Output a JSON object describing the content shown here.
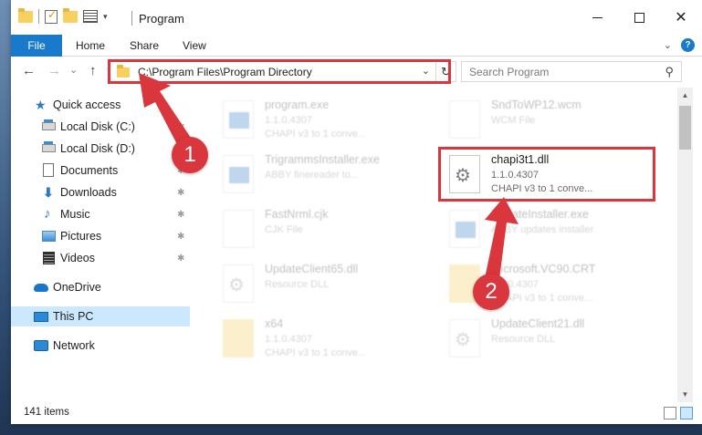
{
  "window": {
    "title": "Program",
    "controls": {
      "minimize": "—",
      "maximize": "☐",
      "close": "✕"
    }
  },
  "ribbon": {
    "tabs": [
      "File",
      "Home",
      "Share",
      "View"
    ],
    "expand_icon": "chevron-down-icon",
    "help_label": "?"
  },
  "nav": {
    "back": "←",
    "forward": "→",
    "recent": "⌄",
    "up": "↑"
  },
  "address": {
    "path": "C:\\Program Files\\Program Directory",
    "dropdown": "⌄",
    "refresh": "↻"
  },
  "search": {
    "placeholder": "Search Program",
    "icon": "⚲"
  },
  "sidebar": {
    "items": [
      {
        "label": "Quick access",
        "icon": "star-icon",
        "pinned": false
      },
      {
        "label": "Local Disk (C:)",
        "icon": "disk-icon",
        "pinned": true
      },
      {
        "label": "Local Disk (D:)",
        "icon": "disk-icon",
        "pinned": false
      },
      {
        "label": "Documents",
        "icon": "documents-icon",
        "pinned": true
      },
      {
        "label": "Downloads",
        "icon": "downloads-icon",
        "pinned": true
      },
      {
        "label": "Music",
        "icon": "music-icon",
        "pinned": true
      },
      {
        "label": "Pictures",
        "icon": "pictures-icon",
        "pinned": true
      },
      {
        "label": "Videos",
        "icon": "videos-icon",
        "pinned": true
      },
      {
        "label": "OneDrive",
        "icon": "cloud-icon",
        "pinned": false
      },
      {
        "label": "This PC",
        "icon": "computer-icon",
        "pinned": false,
        "selected": true
      },
      {
        "label": "Network",
        "icon": "network-icon",
        "pinned": false
      }
    ],
    "pin_glyph": "📌"
  },
  "files": [
    {
      "name": "program.exe",
      "line2": "1.1.0.4307",
      "line3": "CHAPI v3 to 1 conve...",
      "type": "exe",
      "highlighted": false
    },
    {
      "name": "SndToWP12.wcm",
      "line2": "WCM File",
      "line3": "",
      "type": "generic",
      "highlighted": false
    },
    {
      "name": "TrigrammsInstaller.exe",
      "line2": "ABBY finereader to...",
      "line3": "",
      "type": "exe",
      "highlighted": false
    },
    {
      "name": "chapi3t1.dll",
      "line2": "1.1.0.4307",
      "line3": "CHAPI v3 to 1 conve...",
      "type": "dll",
      "highlighted": true
    },
    {
      "name": "FastNrml.cjk",
      "line2": "CJK File",
      "line3": "",
      "type": "generic",
      "highlighted": false
    },
    {
      "name": "UpdateInstaller.exe",
      "line2": "ABBY updates installer",
      "line3": "",
      "type": "exe",
      "highlighted": false
    },
    {
      "name": "UpdateClient65.dll",
      "line2": "Resource DLL",
      "line3": "",
      "type": "dll",
      "highlighted": false
    },
    {
      "name": "Microsoft.VC90.CRT",
      "line2": "1.1.0.4307",
      "line3": "CHAPI v3 to 1 conve...",
      "type": "folder",
      "highlighted": false
    },
    {
      "name": "x64",
      "line2": "1.1.0.4307",
      "line3": "CHAPI v3 to 1 conve...",
      "type": "folder",
      "highlighted": false
    },
    {
      "name": "UpdateClient21.dll",
      "line2": "Resource DLL",
      "line3": "",
      "type": "dll",
      "highlighted": false
    }
  ],
  "status": {
    "item_count": "141 items"
  },
  "annotations": {
    "badge1": "1",
    "badge2": "2",
    "color": "#d9363e"
  }
}
